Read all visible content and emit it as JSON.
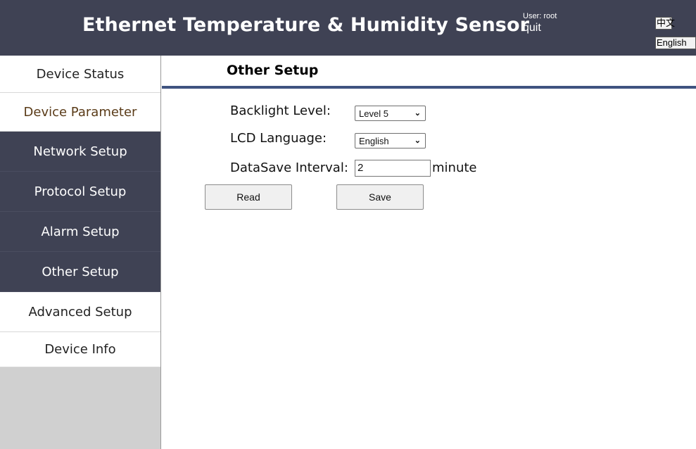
{
  "header": {
    "title": "Ethernet Temperature & Humidity Sensor",
    "user_label": "User: root",
    "quit_label": "quit",
    "lang_zh": "中文",
    "lang_en": "English"
  },
  "sidebar": {
    "items": [
      {
        "label": "Device Status"
      },
      {
        "label": "Device Parameter"
      },
      {
        "label": "Network Setup"
      },
      {
        "label": "Protocol Setup"
      },
      {
        "label": "Alarm Setup"
      },
      {
        "label": "Other Setup"
      },
      {
        "label": "Advanced Setup"
      },
      {
        "label": "Device Info"
      }
    ]
  },
  "main": {
    "section_title": "Other Setup",
    "backlight_label": "Backlight Level:",
    "backlight_value": "Level 5",
    "lcd_language_label": "LCD Language:",
    "lcd_language_value": "English",
    "datasave_label": "DataSave Interval:",
    "datasave_value": "2",
    "datasave_unit": "minute",
    "read_button": "Read",
    "save_button": "Save"
  },
  "colors": {
    "header_bg": "#3f4254",
    "nav_dark_bg": "#3f4254",
    "section_rule": "#3f5380",
    "sidebar_fill": "#d0d0d0"
  }
}
